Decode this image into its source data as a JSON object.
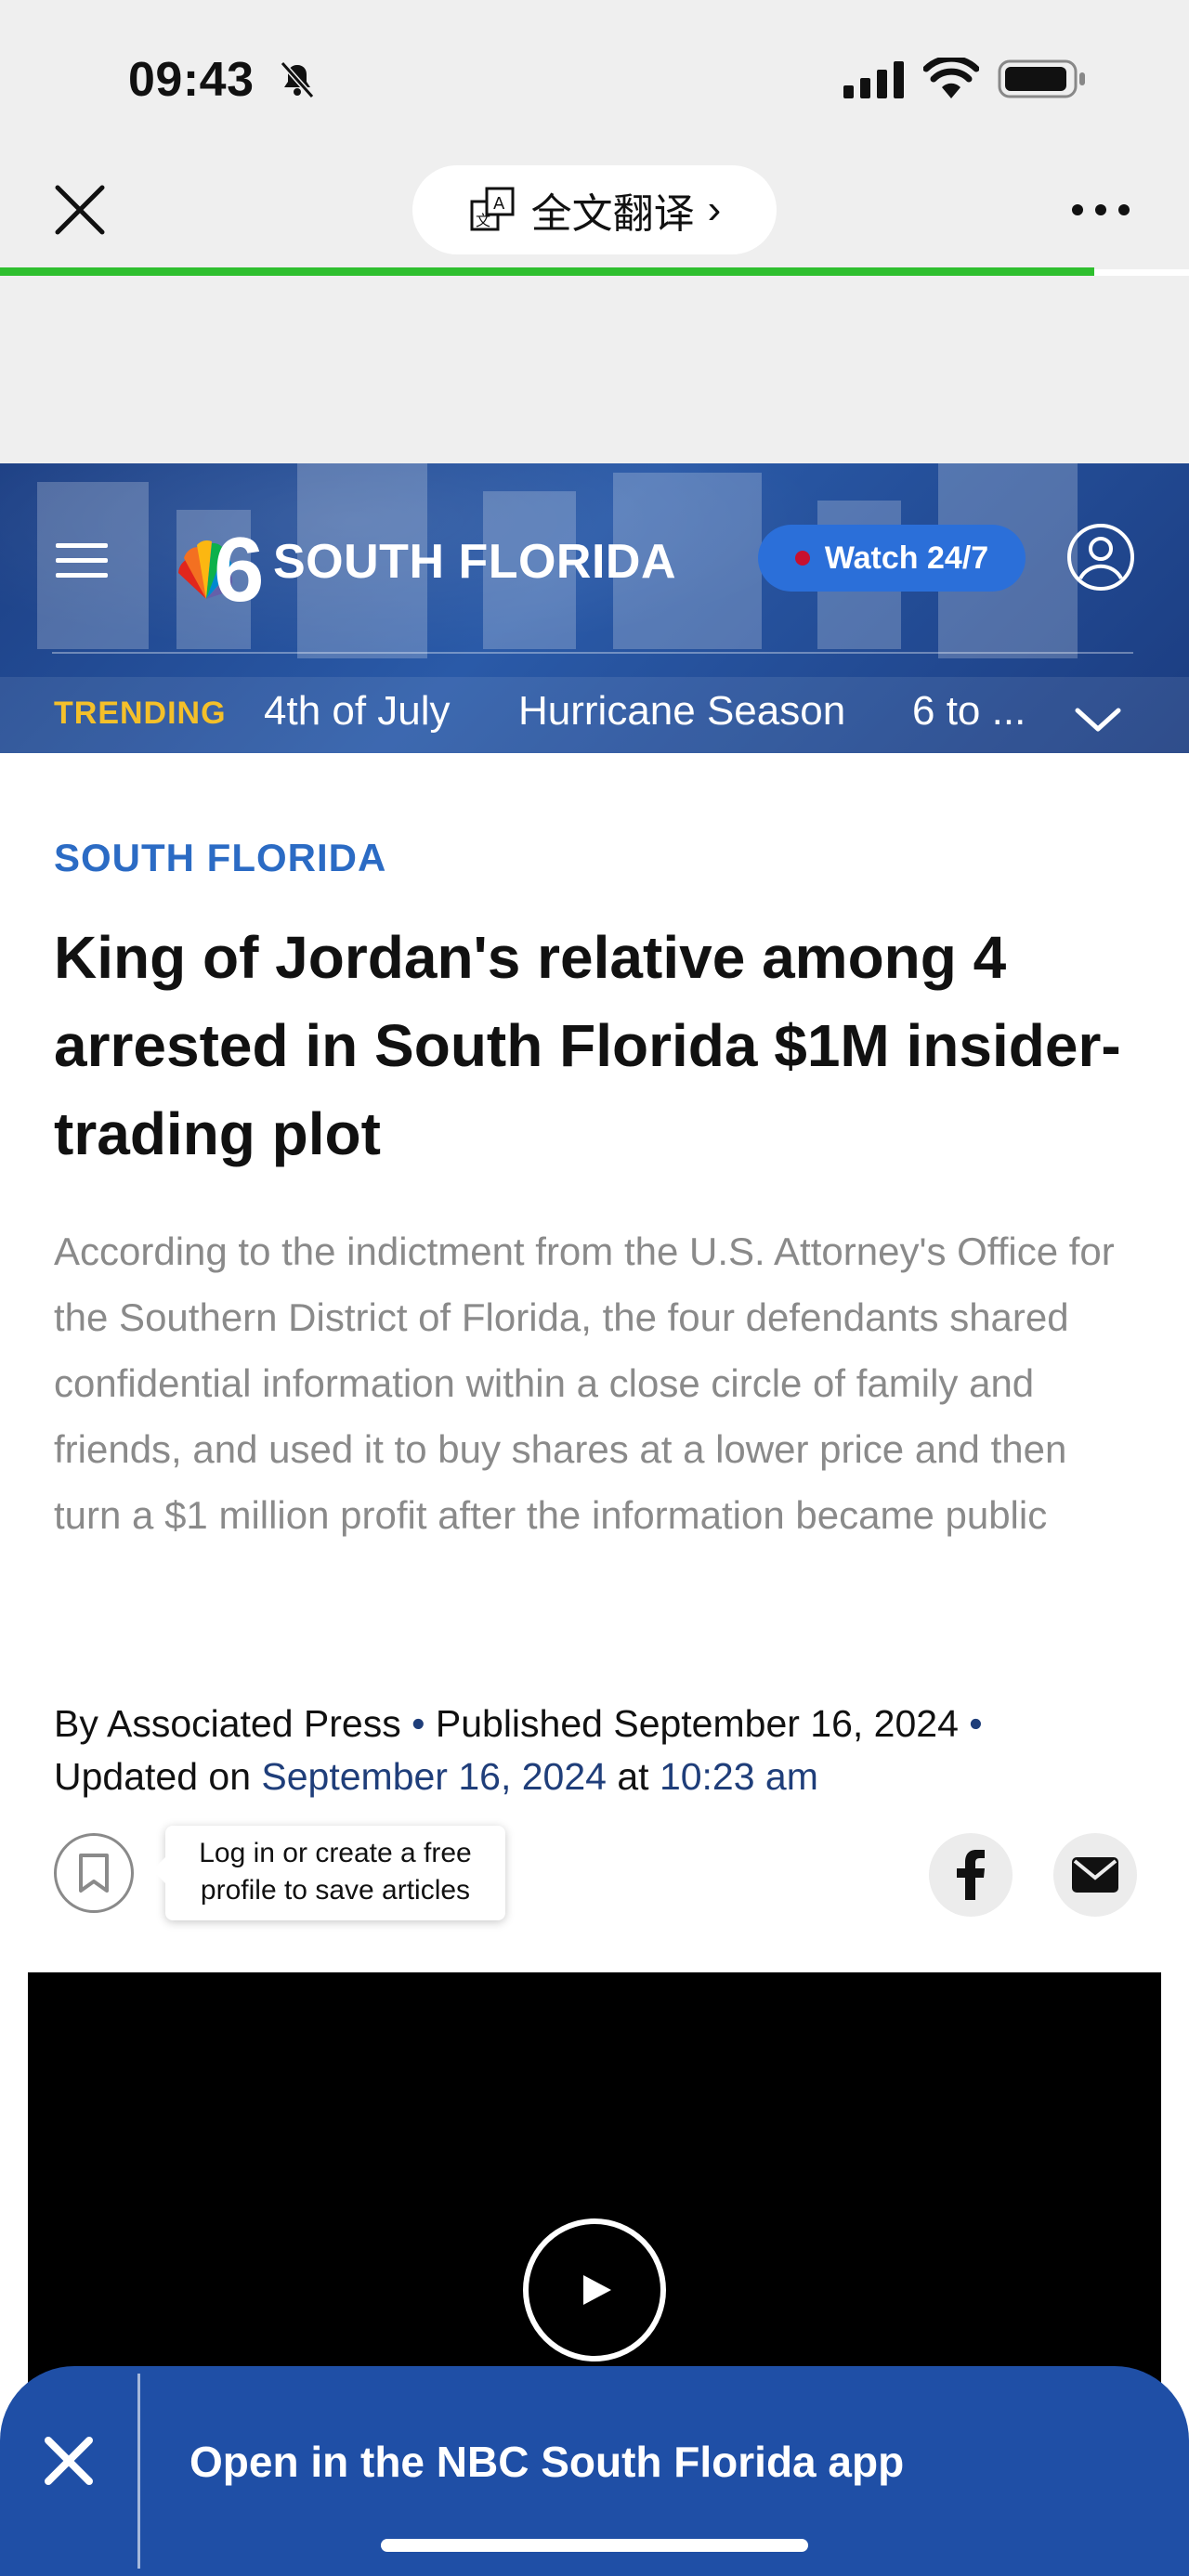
{
  "status_bar": {
    "time": "09:43",
    "icons": [
      "bell-slash-icon",
      "cellular-signal-icon",
      "wifi-icon",
      "battery-icon"
    ]
  },
  "browser": {
    "close_icon": "close-icon",
    "translate_label": "全文翻译",
    "translate_chevron": "›",
    "more_icon": "more-dots-icon",
    "load_progress": 0.92,
    "progress_color": "#2fbf2f"
  },
  "site_header": {
    "logo_text": "SOUTH FLORIDA",
    "watch_label": "Watch 24/7",
    "trending_label": "TRENDING",
    "trending_items": [
      "4th of July",
      "Hurricane Season",
      "6 to ..."
    ],
    "brand_color": "#1f4fa6",
    "accent_yellow": "#f4c02a"
  },
  "article": {
    "kicker": "SOUTH FLORIDA",
    "headline": "King of Jordan's relative among 4 arrested in South Florida $1M insider-trading plot",
    "dek": "According to the indictment from the U.S. Attorney's Office for the Southern District of Florida, the four defendants shared confidential information within a close circle of family and friends, and used it to buy shares at a lower price and then turn a $1 million profit after the information became public",
    "byline": {
      "by": "By Associated Press",
      "sep1": " • ",
      "published": "Published September 16, 2024",
      "sep2": " • ",
      "updated_prefix": "Updated on ",
      "updated_date": "September 16, 2024",
      "at": " at ",
      "updated_time": "10:23 am"
    },
    "save_tooltip_line1": "Log in or create a free",
    "save_tooltip_line2": "profile to save articles"
  },
  "app_banner": {
    "label": "Open in the NBC South Florida app",
    "close_glyph": "✕"
  }
}
